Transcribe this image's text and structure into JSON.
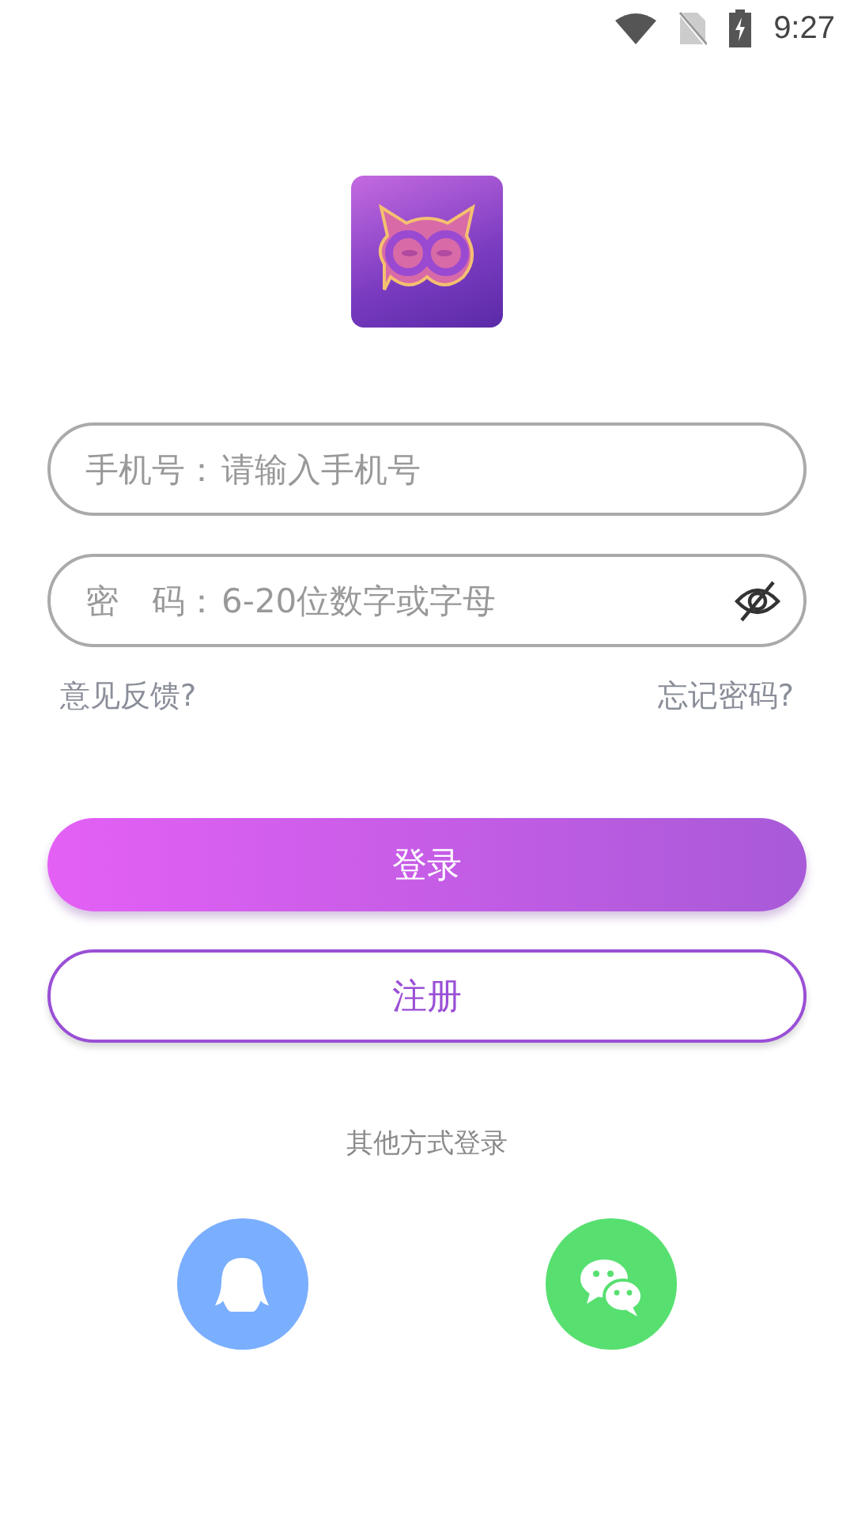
{
  "status_bar": {
    "time": "9:27"
  },
  "fields": [
    {
      "kind": "text",
      "label": "手机号：",
      "placeholder": "请输入手机号"
    },
    {
      "kind": "password",
      "label": "密　码：",
      "placeholder": "6-20位数字或字母"
    }
  ],
  "links": [
    "意见反馈?",
    "忘记密码?"
  ],
  "buttons": [
    {
      "kind": "primary",
      "label": "登录"
    },
    {
      "kind": "outline",
      "label": "注册"
    }
  ],
  "other_login": {
    "title": "其他方式登录",
    "options": [
      {
        "kind": "qq",
        "color": "#7aaeff"
      },
      {
        "kind": "wechat",
        "color": "#57e070"
      }
    ]
  }
}
